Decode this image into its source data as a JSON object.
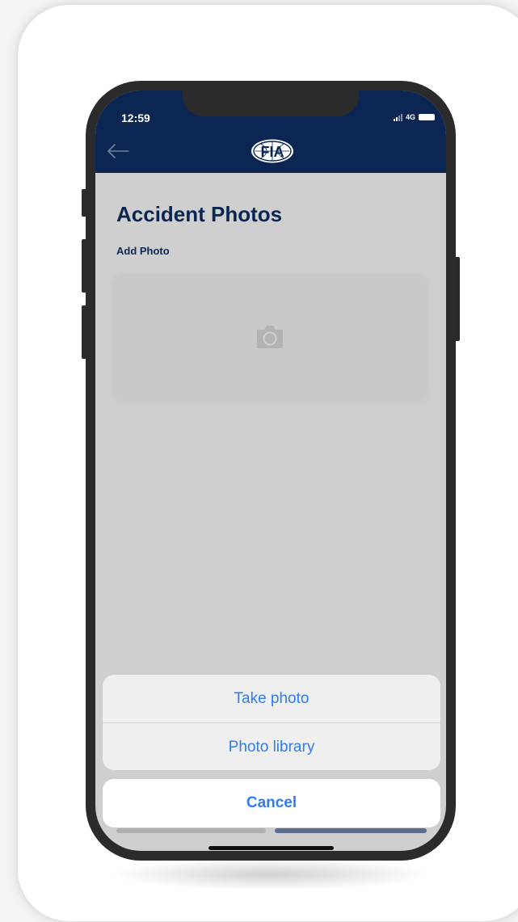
{
  "status_bar": {
    "time": "12:59",
    "network": "4G"
  },
  "header": {
    "logo_text": "FIA",
    "back_icon": "back-arrow-icon",
    "background": "#0b2653"
  },
  "page": {
    "title": "Accident Photos",
    "add_photo_label": "Add Photo",
    "add_photo_icon": "camera-icon"
  },
  "action_sheet": {
    "items": [
      {
        "label": "Take photo"
      },
      {
        "label": "Photo library"
      }
    ],
    "cancel_label": "Cancel",
    "accent_color": "#2f7cf6"
  }
}
